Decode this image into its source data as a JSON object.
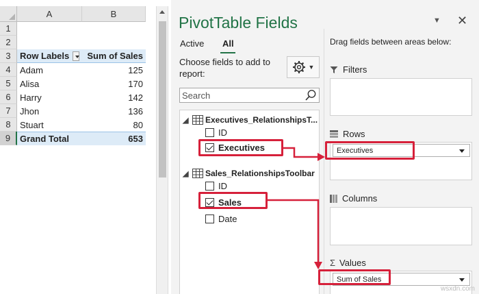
{
  "sheet": {
    "columns": [
      "A",
      "B"
    ],
    "rows": [
      "1",
      "2",
      "3",
      "4",
      "5",
      "6",
      "7",
      "8",
      "9"
    ],
    "header": {
      "row_labels": "Row Labels",
      "sum_of_sales": "Sum of Sales"
    },
    "data": [
      {
        "name": "Adam",
        "value": "125"
      },
      {
        "name": "Alisa",
        "value": "170"
      },
      {
        "name": "Harry",
        "value": "142"
      },
      {
        "name": "Jhon",
        "value": "136"
      },
      {
        "name": "Stuart",
        "value": "80"
      }
    ],
    "total": {
      "label": "Grand Total",
      "value": "653"
    }
  },
  "pane": {
    "title": "PivotTable Fields",
    "tabs": [
      "Active",
      "All"
    ],
    "choose_text": "Choose fields to add to report:",
    "search_placeholder": "Search",
    "tables": [
      {
        "name": "Executives_RelationshipsT...",
        "fields": [
          {
            "name": "ID",
            "checked": false
          },
          {
            "name": "Executives",
            "checked": true
          }
        ]
      },
      {
        "name": "Sales_RelationshipsToolbar",
        "fields": [
          {
            "name": "ID",
            "checked": false
          },
          {
            "name": "Sales",
            "checked": true
          },
          {
            "name": "Date",
            "checked": false
          }
        ]
      }
    ],
    "drag_hint": "Drag fields between areas below:",
    "areas": {
      "filters": "Filters",
      "rows": "Rows",
      "columns": "Columns",
      "values": "Values"
    },
    "rows_pill": "Executives",
    "values_pill": "Sum of Sales"
  },
  "colors": {
    "accent": "#217346",
    "highlight": "#d6203a",
    "pivot_header": "#ddebf7"
  },
  "watermark": "wsxdn.com"
}
